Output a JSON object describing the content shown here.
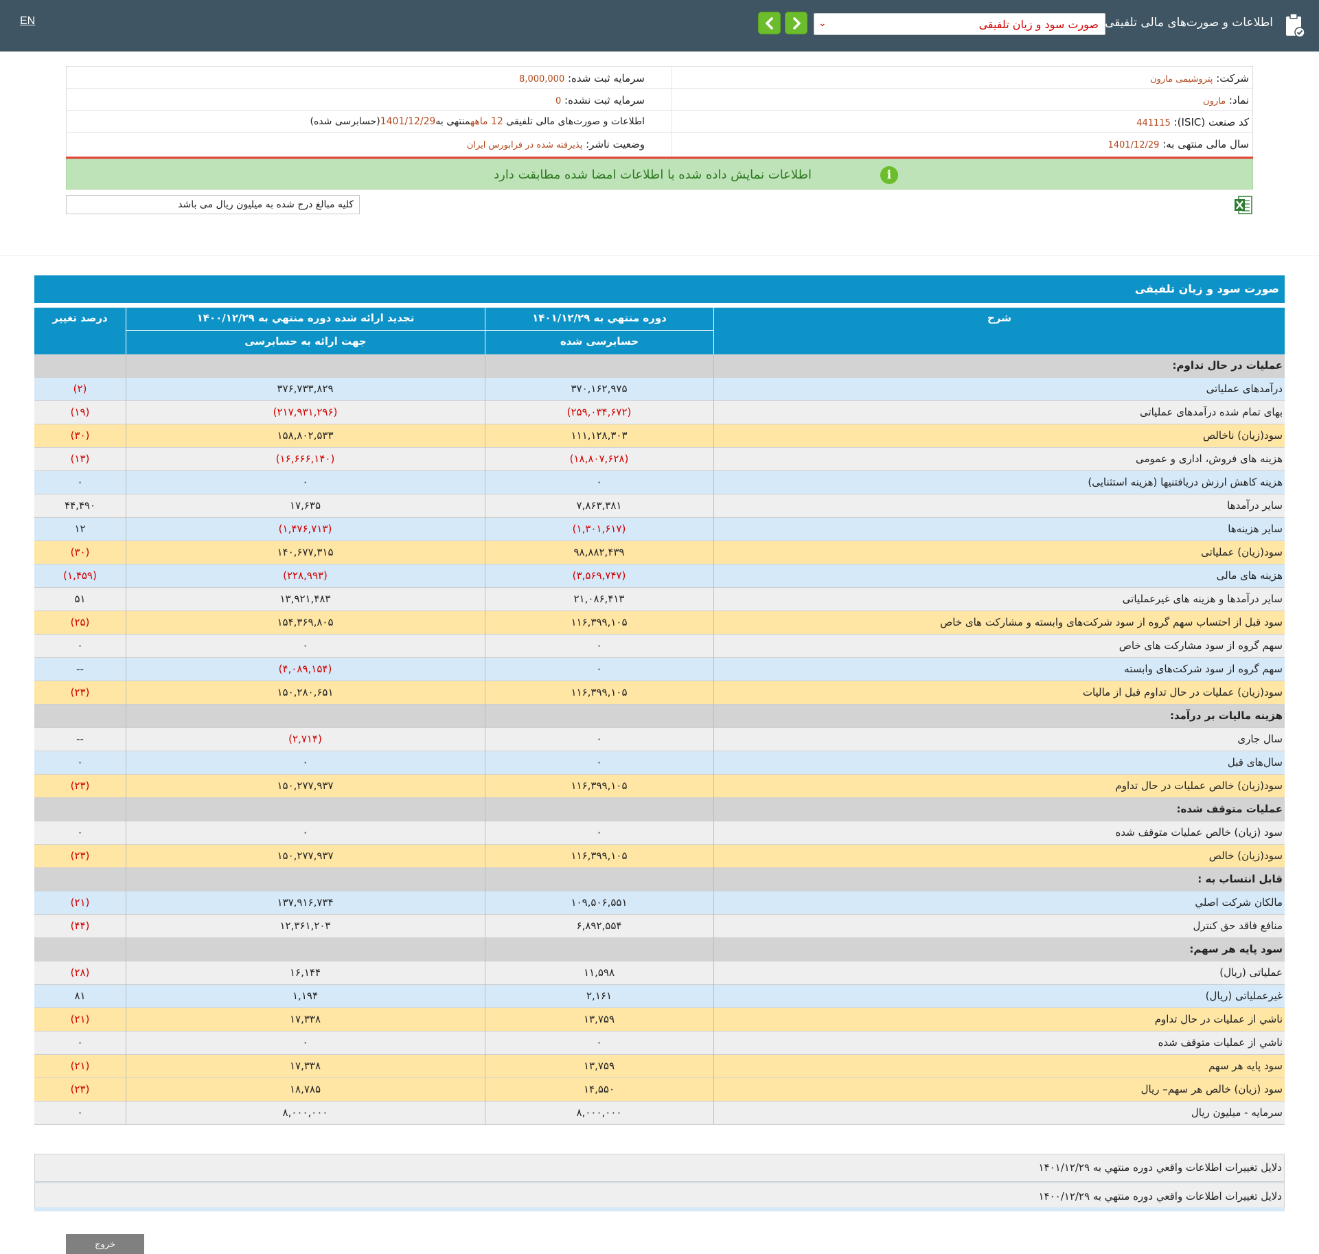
{
  "topbar": {
    "lang": "EN",
    "title": "اطلاعات و صورت‌های مالی تلفیقی",
    "selected_statement": "صورت سود و زیان تلفیقی"
  },
  "company": {
    "company_label": "شرکت:",
    "company_value": "پتروشیمی مارون",
    "symbol_label": "نماد:",
    "symbol_value": "مارون",
    "isic_label": "کد صنعت (ISIC):",
    "isic_value": "441115",
    "fiscal_label": "سال مالی منتهی به:",
    "fiscal_value": "1401/12/29",
    "reg_capital_label": "سرمایه ثبت شده:",
    "reg_capital_value": "8,000,000",
    "unreg_capital_label": "سرمایه ثبت نشده:",
    "unreg_capital_value": "0",
    "report_desc_prefix": "اطلاعات و صورت‌های مالی تلفیقی",
    "report_desc_period": "12 ماهه",
    "report_desc_mid": "منتهی به",
    "report_desc_date": "1401/12/29",
    "report_desc_suffix": "(حسابرسی شده)",
    "publisher_label": "وضعیت ناشر:",
    "publisher_value": "پذیرفته شده در فرابورس ایران"
  },
  "banner": {
    "text": "اطلاعات نمایش داده شده با اطلاعات امضا شده مطابقت دارد",
    "icon": "i"
  },
  "unit_note": "کلیه مبالغ درج شده به میلیون ریال می باشد",
  "table": {
    "title": "صورت سود و زیان تلفیقی",
    "headers": {
      "desc": "شرح",
      "cur_period": "دوره منتهي به ۱۴۰۱/۱۲/۲۹",
      "cur_sub": "حسابرسی شده",
      "prev_period": "تجدید ارائه شده دوره منتهي به ۱۴۰۰/۱۲/۲۹",
      "prev_sub": "جهت ارائه به حسابرسی",
      "pct": "درصد تغییر"
    },
    "rows": [
      {
        "type": "section",
        "desc": "عملیات در حال تداوم:",
        "cur": "",
        "prev": "",
        "pct": ""
      },
      {
        "type": "blue",
        "desc": "درآمدهای عملیاتی",
        "cur": "۳۷۰,۱۶۲,۹۷۵",
        "prev": "۳۷۶,۷۳۳,۸۲۹",
        "pct": "(۲)"
      },
      {
        "type": "gray",
        "desc": "بهاى تمام شده درآمدهای عملیاتی",
        "cur": "(۲۵۹,۰۳۴,۶۷۲)",
        "prev": "(۲۱۷,۹۳۱,۲۹۶)",
        "pct": "(۱۹)"
      },
      {
        "type": "yellow",
        "desc": "سود(زيان) ناخالص",
        "cur": "۱۱۱,۱۲۸,۳۰۳",
        "prev": "۱۵۸,۸۰۲,۵۳۳",
        "pct": "(۳۰)"
      },
      {
        "type": "gray",
        "desc": "هزينه هاى فروش، ادارى و عمومى",
        "cur": "(۱۸,۸۰۷,۶۲۸)",
        "prev": "(۱۶,۶۶۶,۱۴۰)",
        "pct": "(۱۳)"
      },
      {
        "type": "blue",
        "desc": "هزینه کاهش ارزش دریافتنیها (هزینه استثنایی)",
        "cur": "۰",
        "prev": "۰",
        "pct": "۰"
      },
      {
        "type": "gray",
        "desc": "سایر درآمدها",
        "cur": "۷,۸۶۳,۳۸۱",
        "prev": "۱۷,۶۳۵",
        "pct": "۴۴,۴۹۰"
      },
      {
        "type": "blue",
        "desc": "سایر هزینه‌ها",
        "cur": "(۱,۳۰۱,۶۱۷)",
        "prev": "(۱,۴۷۶,۷۱۳)",
        "pct": "۱۲"
      },
      {
        "type": "yellow",
        "desc": "سود(زيان) عملياتى",
        "cur": "۹۸,۸۸۲,۴۳۹",
        "prev": "۱۴۰,۶۷۷,۳۱۵",
        "pct": "(۳۰)"
      },
      {
        "type": "blue",
        "desc": "هزينه هاى مالى",
        "cur": "(۳,۵۶۹,۷۴۷)",
        "prev": "(۲۲۸,۹۹۳)",
        "pct": "(۱,۴۵۹)"
      },
      {
        "type": "gray",
        "desc": "سایر درآمدها و هزینه های غیرعملیاتی",
        "cur": "۲۱,۰۸۶,۴۱۳",
        "prev": "۱۳,۹۲۱,۴۸۳",
        "pct": "۵۱"
      },
      {
        "type": "yellow",
        "desc": "سود قبل از احتساب سهم گروه از سود شرکت‌های وابسته و مشارکت های خاص",
        "cur": "۱۱۶,۳۹۹,۱۰۵",
        "prev": "۱۵۴,۳۶۹,۸۰۵",
        "pct": "(۲۵)"
      },
      {
        "type": "gray",
        "desc": "سهم گروه از سود مشارکت های خاص",
        "cur": "۰",
        "prev": "۰",
        "pct": "۰"
      },
      {
        "type": "blue",
        "desc": "سهم گروه از سود شرکت‌های وابسته",
        "cur": "۰",
        "prev": "(۴,۰۸۹,۱۵۴)",
        "pct": "--"
      },
      {
        "type": "yellow",
        "desc": "سود(زيان) عمليات در حال تداوم قبل از ماليات",
        "cur": "۱۱۶,۳۹۹,۱۰۵",
        "prev": "۱۵۰,۲۸۰,۶۵۱",
        "pct": "(۲۳)"
      },
      {
        "type": "section",
        "desc": "هزينه ماليات بر درآمد:",
        "cur": "",
        "prev": "",
        "pct": ""
      },
      {
        "type": "gray",
        "desc": "سال جاری",
        "cur": "۰",
        "prev": "(۲,۷۱۴)",
        "pct": "--"
      },
      {
        "type": "blue",
        "desc": "سال‌های قبل",
        "cur": "۰",
        "prev": "۰",
        "pct": "۰"
      },
      {
        "type": "yellow",
        "desc": "سود(زيان) خالص عمليات در حال تداوم",
        "cur": "۱۱۶,۳۹۹,۱۰۵",
        "prev": "۱۵۰,۲۷۷,۹۳۷",
        "pct": "(۲۳)"
      },
      {
        "type": "section",
        "desc": "عملیات متوقف شده:",
        "cur": "",
        "prev": "",
        "pct": ""
      },
      {
        "type": "gray",
        "desc": "سود (زيان) خالص عمليات متوقف شده",
        "cur": "۰",
        "prev": "۰",
        "pct": "۰"
      },
      {
        "type": "yellow",
        "desc": "سود(زيان) خالص",
        "cur": "۱۱۶,۳۹۹,۱۰۵",
        "prev": "۱۵۰,۲۷۷,۹۳۷",
        "pct": "(۲۳)"
      },
      {
        "type": "section",
        "desc": "قابل انتساب به :",
        "cur": "",
        "prev": "",
        "pct": ""
      },
      {
        "type": "blue",
        "desc": "مالکان شرکت اصلي",
        "cur": "۱۰۹,۵۰۶,۵۵۱",
        "prev": "۱۳۷,۹۱۶,۷۳۴",
        "pct": "(۲۱)"
      },
      {
        "type": "gray",
        "desc": "منافع فاقد حق کنترل",
        "cur": "۶,۸۹۲,۵۵۴",
        "prev": "۱۲,۳۶۱,۲۰۳",
        "pct": "(۴۴)"
      },
      {
        "type": "section",
        "desc": "سود پایه هر سهم:",
        "cur": "",
        "prev": "",
        "pct": ""
      },
      {
        "type": "gray",
        "desc": "عملیاتی (ریال)",
        "cur": "۱۱,۵۹۸",
        "prev": "۱۶,۱۴۴",
        "pct": "(۲۸)"
      },
      {
        "type": "blue",
        "desc": "غیرعملیاتی (ریال)",
        "cur": "۲,۱۶۱",
        "prev": "۱,۱۹۴",
        "pct": "۸۱"
      },
      {
        "type": "yellow",
        "desc": "ناشي از عمليات در حال تداوم",
        "cur": "۱۳,۷۵۹",
        "prev": "۱۷,۳۳۸",
        "pct": "(۲۱)"
      },
      {
        "type": "gray",
        "desc": "ناشي از عمليات متوقف شده",
        "cur": "۰",
        "prev": "۰",
        "pct": "۰"
      },
      {
        "type": "yellow",
        "desc": "سود پایه هر سهم",
        "cur": "۱۳,۷۵۹",
        "prev": "۱۷,۳۳۸",
        "pct": "(۲۱)"
      },
      {
        "type": "yellow",
        "desc": "سود (زیان) خالص هر سهم– ریال",
        "cur": "۱۴,۵۵۰",
        "prev": "۱۸,۷۸۵",
        "pct": "(۲۳)"
      },
      {
        "type": "gray",
        "desc": "سرمایه - میلیون ریال",
        "cur": "۸,۰۰۰,۰۰۰",
        "prev": "۸,۰۰۰,۰۰۰",
        "pct": "۰"
      }
    ]
  },
  "reasons": {
    "cur": "دلایل تغییرات اطلاعات واقعي دوره منتهي به ۱۴۰۱/۱۲/۲۹",
    "prev": "دلایل تغییرات اطلاعات واقعي دوره منتهي به ۱۴۰۰/۱۲/۲۹"
  },
  "exit_label": "خروج",
  "colors": {
    "topbar": "#3f5563",
    "accent_blue": "#0e93c8",
    "nav_green": "#6cbd2b",
    "negative_red": "#d00000"
  }
}
